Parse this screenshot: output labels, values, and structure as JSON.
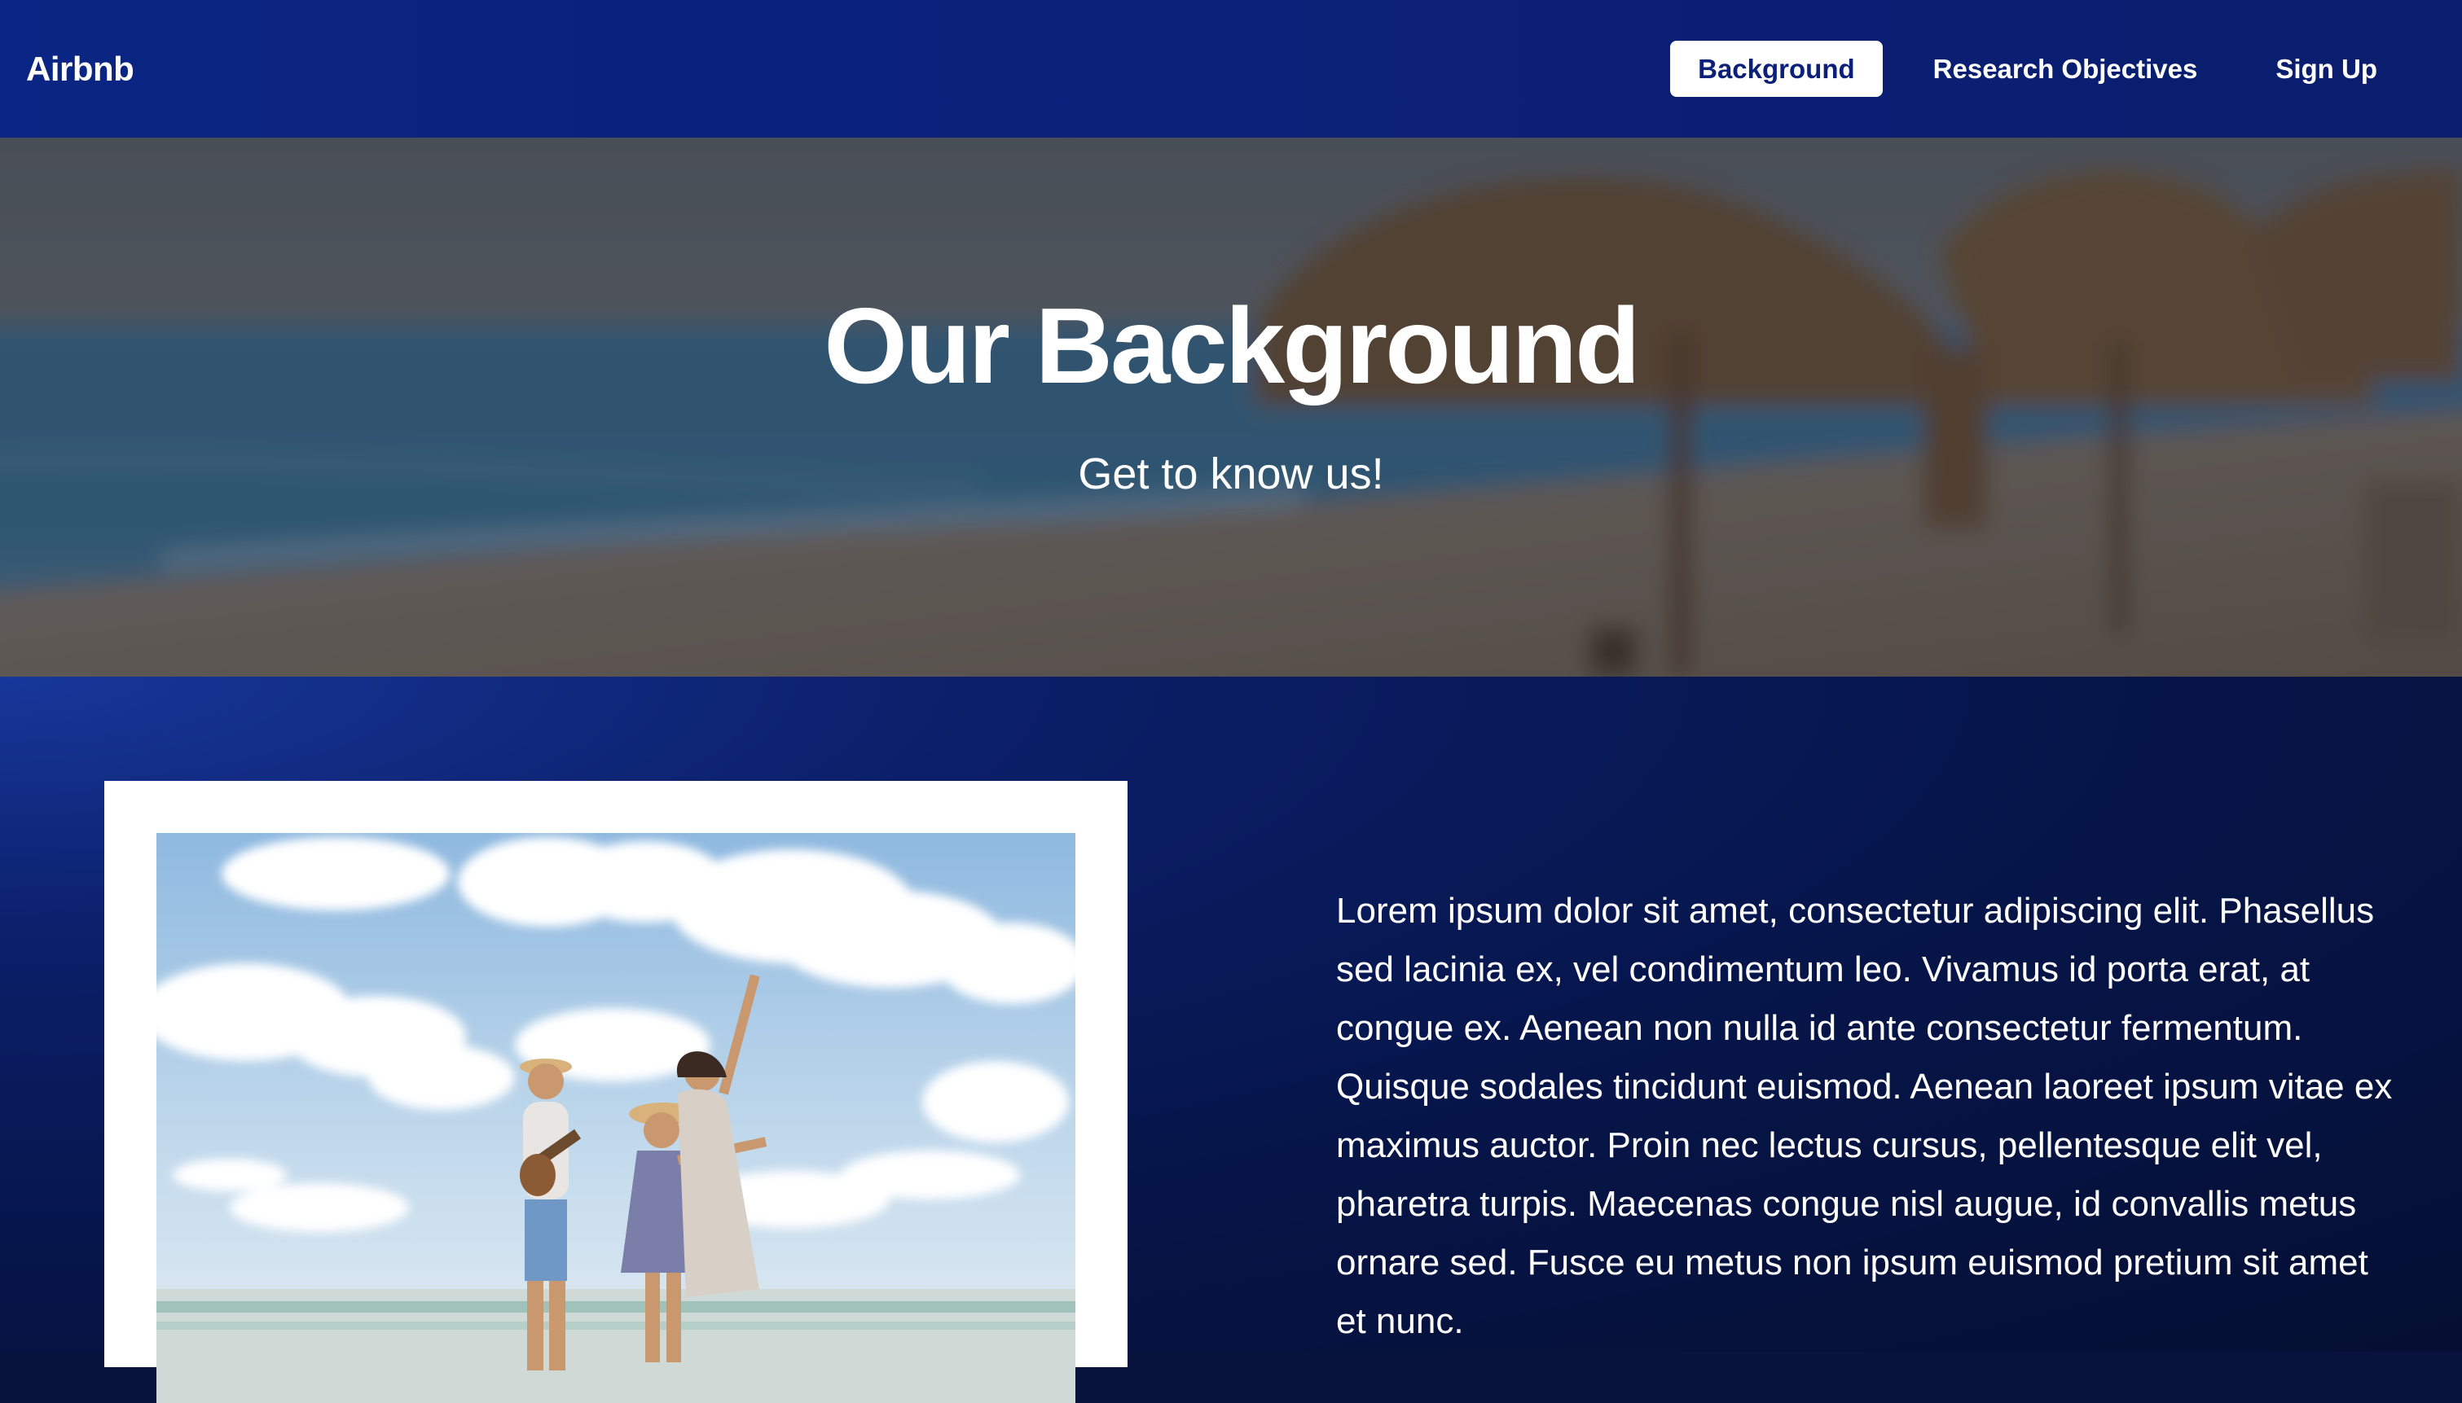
{
  "nav": {
    "brand": "Airbnb",
    "links": [
      {
        "label": "Background",
        "active": true
      },
      {
        "label": "Research Objectives",
        "active": false
      },
      {
        "label": "Sign Up",
        "active": false
      }
    ]
  },
  "hero": {
    "title": "Our Background",
    "subtitle": "Get to know us!"
  },
  "main": {
    "paragraph": "Lorem ipsum dolor sit amet, consectetur adipiscing elit. Phasellus sed lacinia ex, vel condimentum leo. Vivamus id porta erat, at congue ex. Aenean non nulla id ante consectetur fermentum. Quisque sodales tincidunt euismod. Aenean laoreet ipsum vitae ex maximus auctor. Proin nec lectus cursus, pellentesque elit vel, pharetra turpis. Maecenas congue nisl augue, id convallis metus ornare sed. Fusce eu metus non ipsum euismod pretium sit amet et nunc."
  },
  "colors": {
    "nav_bg": "#0b2078",
    "accent_white": "#ffffff",
    "content_bg": "#06154a"
  }
}
